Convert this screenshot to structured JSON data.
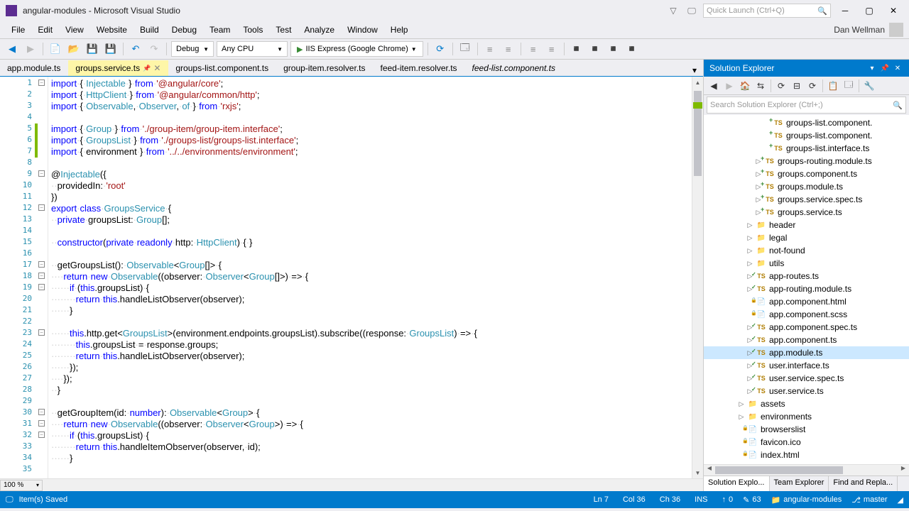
{
  "window": {
    "title": "angular-modules - Microsoft Visual Studio",
    "quick_launch_placeholder": "Quick Launch (Ctrl+Q)"
  },
  "menu": [
    "File",
    "Edit",
    "View",
    "Website",
    "Build",
    "Debug",
    "Team",
    "Tools",
    "Test",
    "Analyze",
    "Window",
    "Help"
  ],
  "user": {
    "name": "Dan Wellman"
  },
  "toolbar": {
    "config": "Debug",
    "platform": "Any CPU",
    "run_label": "IIS Express (Google Chrome)"
  },
  "tabs": [
    {
      "name": "app.module.ts",
      "active": false,
      "pinned": false,
      "preview": false
    },
    {
      "name": "groups.service.ts",
      "active": true,
      "pinned": true,
      "preview": false
    },
    {
      "name": "groups-list.component.ts",
      "active": false,
      "pinned": false,
      "preview": false
    },
    {
      "name": "group-item.resolver.ts",
      "active": false,
      "pinned": false,
      "preview": false
    },
    {
      "name": "feed-item.resolver.ts",
      "active": false,
      "pinned": false,
      "preview": false
    },
    {
      "name": "feed-list.component.ts",
      "active": false,
      "pinned": false,
      "preview": true
    }
  ],
  "code_lines_count": 35,
  "editor": {
    "zoom": "100 %"
  },
  "solution_explorer": {
    "title": "Solution Explorer",
    "search_placeholder": "Search Solution Explorer (Ctrl+;)",
    "items": [
      {
        "indent": 7,
        "icon": "ts",
        "badge": "plus",
        "label": "groups-list.component."
      },
      {
        "indent": 7,
        "icon": "ts",
        "badge": "plus",
        "label": "groups-list.component."
      },
      {
        "indent": 7,
        "icon": "ts",
        "badge": "plus",
        "label": "groups-list.interface.ts"
      },
      {
        "indent": 6,
        "arrow": "▷",
        "icon": "ts",
        "badge": "plus",
        "label": "groups-routing.module.ts"
      },
      {
        "indent": 6,
        "arrow": "▷",
        "icon": "ts",
        "badge": "plus",
        "label": "groups.component.ts"
      },
      {
        "indent": 6,
        "arrow": "▷",
        "icon": "ts",
        "badge": "plus",
        "label": "groups.module.ts"
      },
      {
        "indent": 6,
        "arrow": "▷",
        "icon": "ts",
        "badge": "plus",
        "label": "groups.service.spec.ts"
      },
      {
        "indent": 6,
        "arrow": "▷",
        "icon": "ts",
        "badge": "plus",
        "label": "groups.service.ts"
      },
      {
        "indent": 5,
        "arrow": "▷",
        "icon": "folder",
        "label": "header"
      },
      {
        "indent": 5,
        "arrow": "▷",
        "icon": "folder",
        "label": "legal"
      },
      {
        "indent": 5,
        "arrow": "▷",
        "icon": "folder",
        "label": "not-found"
      },
      {
        "indent": 5,
        "arrow": "▷",
        "icon": "folder",
        "label": "utils"
      },
      {
        "indent": 5,
        "arrow": "▷",
        "icon": "ts",
        "badge": "check",
        "label": "app-routes.ts"
      },
      {
        "indent": 5,
        "arrow": "▷",
        "icon": "ts",
        "badge": "check",
        "label": "app-routing.module.ts"
      },
      {
        "indent": 5,
        "icon": "file",
        "badge": "lock",
        "label": "app.component.html"
      },
      {
        "indent": 5,
        "icon": "file",
        "badge": "lock",
        "label": "app.component.scss"
      },
      {
        "indent": 5,
        "arrow": "▷",
        "icon": "ts",
        "badge": "check",
        "label": "app.component.spec.ts"
      },
      {
        "indent": 5,
        "arrow": "▷",
        "icon": "ts",
        "badge": "check",
        "label": "app.component.ts"
      },
      {
        "indent": 5,
        "arrow": "▷",
        "icon": "ts",
        "badge": "check",
        "label": "app.module.ts",
        "selected": true
      },
      {
        "indent": 5,
        "arrow": "▷",
        "icon": "ts",
        "badge": "check",
        "label": "user.interface.ts"
      },
      {
        "indent": 5,
        "arrow": "▷",
        "icon": "ts",
        "badge": "check",
        "label": "user.service.spec.ts"
      },
      {
        "indent": 5,
        "arrow": "▷",
        "icon": "ts",
        "badge": "check",
        "label": "user.service.ts"
      },
      {
        "indent": 4,
        "arrow": "▷",
        "icon": "folder",
        "label": "assets"
      },
      {
        "indent": 4,
        "arrow": "▷",
        "icon": "folder",
        "label": "environments"
      },
      {
        "indent": 4,
        "icon": "file",
        "badge": "lock",
        "label": "browserslist"
      },
      {
        "indent": 4,
        "icon": "file",
        "badge": "lock",
        "label": "favicon.ico"
      },
      {
        "indent": 4,
        "icon": "file",
        "badge": "lock",
        "label": "index.html"
      }
    ],
    "bottom_tabs": [
      "Solution Explo...",
      "Team Explorer",
      "Find and Repla..."
    ]
  },
  "statusbar": {
    "left": "Item(s) Saved",
    "line": "Ln 7",
    "col": "Col 36",
    "ch": "Ch 36",
    "ins": "INS",
    "publish_count": "0",
    "pending_count": "63",
    "project": "angular-modules",
    "branch": "master"
  }
}
